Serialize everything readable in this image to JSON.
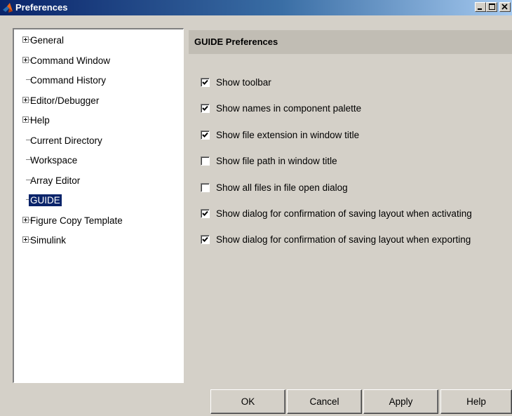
{
  "window": {
    "title": "Preferences",
    "controls": [
      "minimize",
      "maximize",
      "close"
    ]
  },
  "tree": {
    "items": [
      {
        "label": "General",
        "expandable": true,
        "selected": false
      },
      {
        "label": "Command Window",
        "expandable": true,
        "selected": false
      },
      {
        "label": "Command History",
        "expandable": false,
        "selected": false
      },
      {
        "label": "Editor/Debugger",
        "expandable": true,
        "selected": false
      },
      {
        "label": "Help",
        "expandable": true,
        "selected": false
      },
      {
        "label": "Current Directory",
        "expandable": false,
        "selected": false
      },
      {
        "label": "Workspace",
        "expandable": false,
        "selected": false
      },
      {
        "label": "Array Editor",
        "expandable": false,
        "selected": false
      },
      {
        "label": "GUIDE",
        "expandable": false,
        "selected": true
      },
      {
        "label": "Figure Copy Template",
        "expandable": true,
        "selected": false
      },
      {
        "label": "Simulink",
        "expandable": true,
        "selected": false
      }
    ]
  },
  "panel": {
    "title": "GUIDE Preferences",
    "options": [
      {
        "label": "Show toolbar",
        "checked": true
      },
      {
        "label": "Show names in component palette",
        "checked": true
      },
      {
        "label": "Show file extension in window title",
        "checked": true
      },
      {
        "label": "Show file path in window title",
        "checked": false
      },
      {
        "label": "Show all files in file open dialog",
        "checked": false
      },
      {
        "label": "Show dialog for confirmation of saving layout when activating",
        "checked": true
      },
      {
        "label": "Show dialog for confirmation of saving layout when exporting",
        "checked": true
      }
    ]
  },
  "buttons": {
    "ok": "OK",
    "cancel": "Cancel",
    "apply": "Apply",
    "help": "Help"
  },
  "colors": {
    "title_gradient_start": "#0a246a",
    "title_gradient_end": "#a6caf0",
    "selection": "#0a246a",
    "dialog_bg": "#d4d0c8"
  }
}
